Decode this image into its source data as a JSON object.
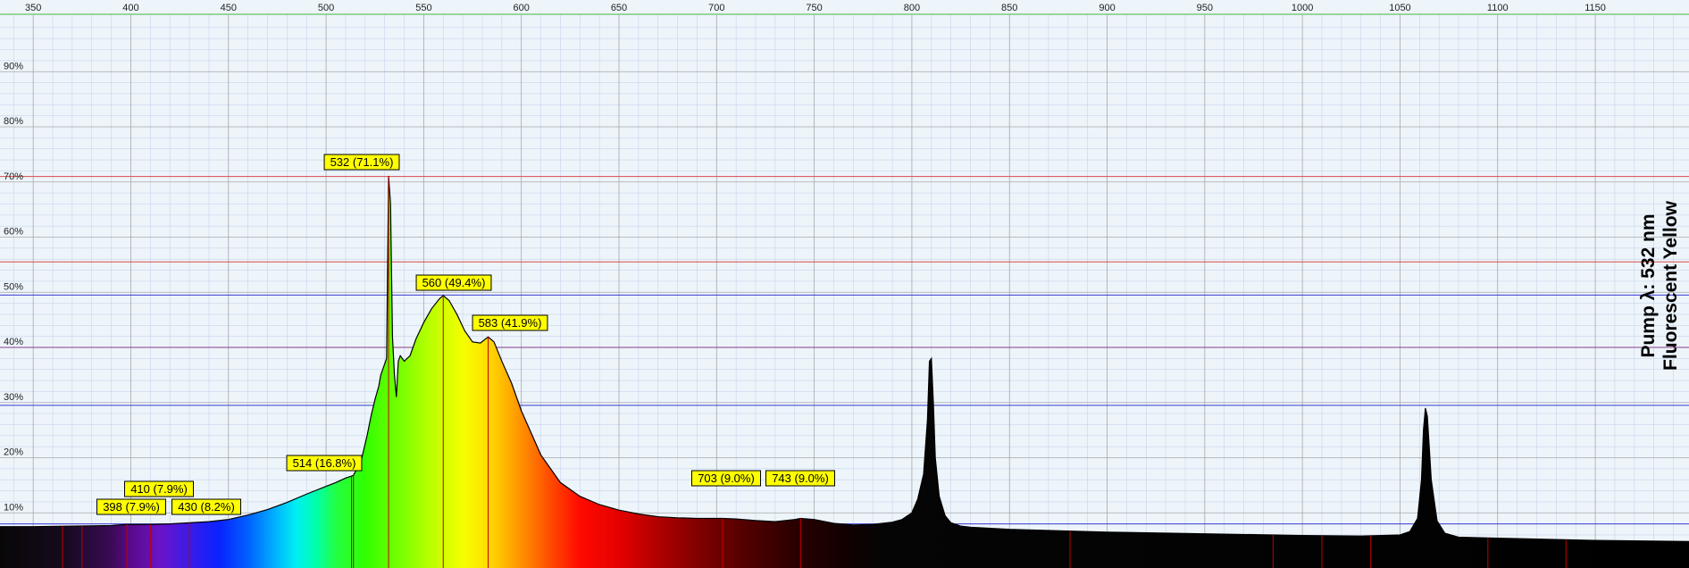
{
  "colors": {
    "background": "#edf5fb",
    "top_axis_line": "#7fc97f",
    "minor_grid": "#c9d3ea",
    "major_grid": "#a7a7a7",
    "spectrum_dark": "#000000",
    "label_fill": "#ffff00",
    "label_border": "#000000",
    "peak_marker": "#c00000",
    "ref_line_red": "#d94b4b",
    "ref_line_blue": "#3b3bd0",
    "ref_line_purple": "#8a3b8a"
  },
  "chart_data": {
    "type": "area",
    "title_lines": [
      "Pump λ: 532 nm",
      "Fluorescent Yellow"
    ],
    "xlabel": "",
    "ylabel": "",
    "xlim": [
      333,
      1198
    ],
    "ylim": [
      0,
      100
    ],
    "x_ticks": [
      350,
      400,
      450,
      500,
      550,
      600,
      650,
      700,
      750,
      800,
      850,
      900,
      950,
      1000,
      1050,
      1100,
      1150
    ],
    "y_ticks": [
      10,
      20,
      30,
      40,
      50,
      60,
      70,
      80,
      90
    ],
    "y_tick_format": "percent",
    "grid": true,
    "reference_lines": [
      {
        "y": 71.0,
        "color": "red"
      },
      {
        "y": 55.5,
        "color": "red"
      },
      {
        "y": 49.5,
        "color": "blue"
      },
      {
        "y": 40.0,
        "color": "purple"
      },
      {
        "y": 29.5,
        "color": "blue"
      },
      {
        "y": 8.0,
        "color": "blue"
      }
    ],
    "series": [
      {
        "x": [
          333,
          350,
          370,
          390,
          398,
          410,
          420,
          430,
          440,
          450,
          460,
          470,
          480,
          490,
          500,
          505,
          510,
          514,
          518,
          521,
          523,
          525,
          527,
          528,
          529,
          530,
          531,
          532,
          533,
          534,
          535,
          536,
          537,
          538,
          540,
          543,
          546,
          550,
          554,
          558,
          560,
          563,
          567,
          571,
          575,
          579,
          583,
          586,
          590,
          595,
          600,
          610,
          620,
          630,
          640,
          650,
          660,
          670,
          680,
          690,
          700,
          703,
          710,
          720,
          730,
          740,
          743,
          750,
          760,
          770,
          780,
          790,
          795,
          800,
          803,
          806,
          808,
          809,
          810,
          811,
          812,
          814,
          817,
          820,
          825,
          830,
          850,
          900,
          950,
          1000,
          1030,
          1050,
          1055,
          1059,
          1061,
          1062,
          1063,
          1064,
          1066,
          1069,
          1073,
          1080,
          1100,
          1150,
          1198
        ],
        "values": [
          7.5,
          7.5,
          7.6,
          7.7,
          7.9,
          7.9,
          8.0,
          8.2,
          8.4,
          8.8,
          9.6,
          10.6,
          11.9,
          13.4,
          14.8,
          15.5,
          16.3,
          16.8,
          19.5,
          24.0,
          27.5,
          30.5,
          33.0,
          35.0,
          36.0,
          37.0,
          38.0,
          71.1,
          66.0,
          42.0,
          35.0,
          31.0,
          37.5,
          38.5,
          37.5,
          38.5,
          41.5,
          44.5,
          47.0,
          48.8,
          49.4,
          48.5,
          46.0,
          43.0,
          41.0,
          40.8,
          41.9,
          41.0,
          37.5,
          33.5,
          28.5,
          20.5,
          15.5,
          13.0,
          11.5,
          10.5,
          9.8,
          9.3,
          9.1,
          9.0,
          9.0,
          9.0,
          8.9,
          8.6,
          8.4,
          8.8,
          9.0,
          8.8,
          8.1,
          7.8,
          7.9,
          8.3,
          8.8,
          10.0,
          12.5,
          17.0,
          27.0,
          37.5,
          38.0,
          30.0,
          20.0,
          13.0,
          9.5,
          8.2,
          7.6,
          7.4,
          7.0,
          6.5,
          6.2,
          5.9,
          5.8,
          6.0,
          6.6,
          9.0,
          16.0,
          25.0,
          29.0,
          27.5,
          16.0,
          8.5,
          6.3,
          5.6,
          5.4,
          5.0,
          4.8
        ]
      }
    ],
    "peak_labels": [
      {
        "x": 532,
        "y": 71.1,
        "text": "532 (71.1%)"
      },
      {
        "x": 560,
        "y": 49.4,
        "text": "560 (49.4%)"
      },
      {
        "x": 583,
        "y": 41.9,
        "text": "583 (41.9%)"
      },
      {
        "x": 514,
        "y": 16.8,
        "text": "514 (16.8%)"
      },
      {
        "x": 410,
        "y": 7.9,
        "text": "410 (7.9%)"
      },
      {
        "x": 398,
        "y": 7.9,
        "text": "398 (7.9%)"
      },
      {
        "x": 430,
        "y": 8.2,
        "text": "430 (8.2%)"
      },
      {
        "x": 703,
        "y": 9.0,
        "text": "703 (9.0%)"
      },
      {
        "x": 743,
        "y": 9.0,
        "text": "743 (9.0%)"
      }
    ],
    "unlabeled_peak_markers": [
      365,
      375,
      513,
      881,
      985,
      1010,
      1035,
      1095,
      1135
    ]
  }
}
